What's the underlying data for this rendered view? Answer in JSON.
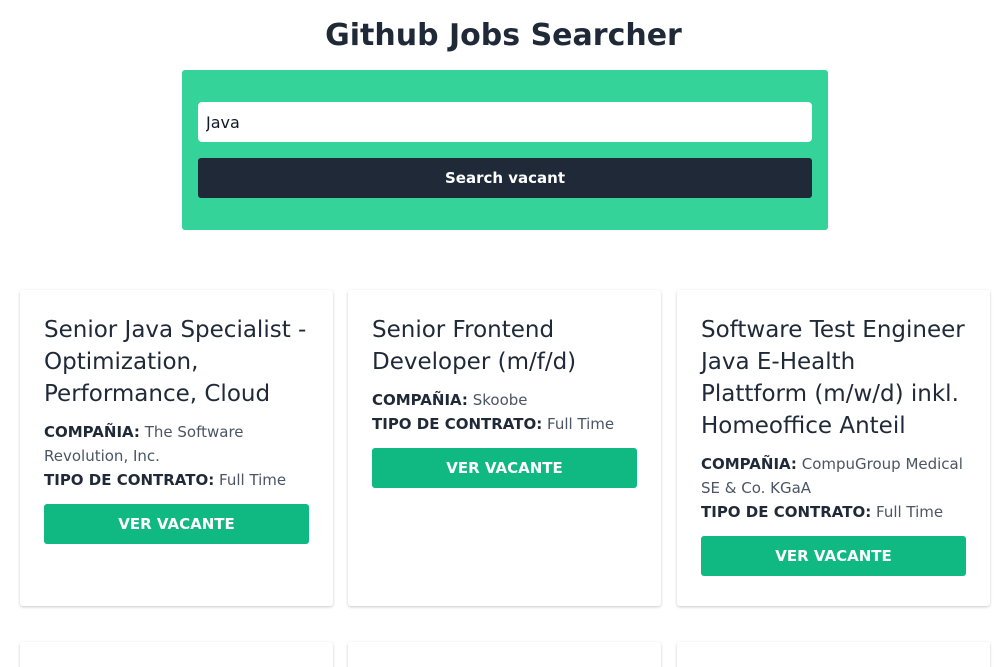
{
  "header": {
    "title": "Github Jobs Searcher"
  },
  "search": {
    "value": "Java",
    "placeholder": "",
    "button_label": "Search vacant"
  },
  "labels": {
    "company": "COMPAÑIA:",
    "contract": "TIPO DE CONTRATO:",
    "view_button": "VER VACANTE"
  },
  "jobs": [
    {
      "title": "Senior Java Specialist - Optimization, Performance, Cloud",
      "company": "The Software Revolution, Inc.",
      "contract": "Full Time"
    },
    {
      "title": "Senior Frontend Developer (m/f/d)",
      "company": "Skoobe",
      "contract": "Full Time"
    },
    {
      "title": "Software Test Engineer Java E-Health Plattform (m/w/d) inkl. Homeoffice Anteil",
      "company": "CompuGroup Medical SE & Co. KGaA",
      "contract": "Full Time"
    }
  ],
  "colors": {
    "panel": "#34d399",
    "search_button": "#1f2937",
    "view_button": "#10b981"
  }
}
